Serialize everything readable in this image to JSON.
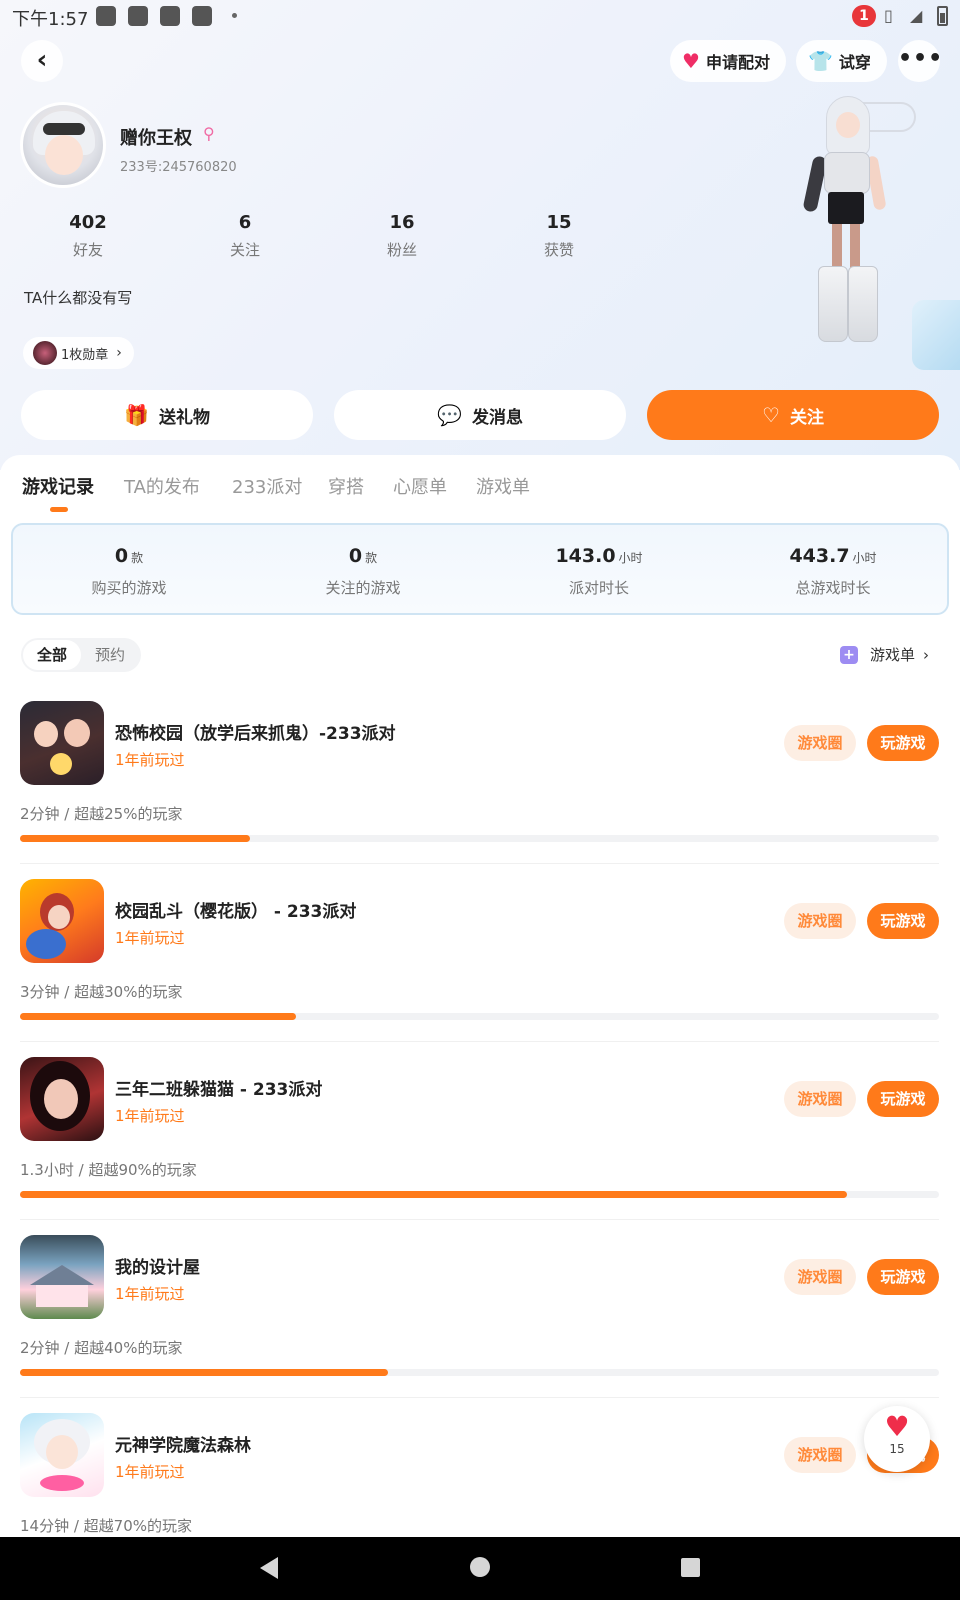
{
  "status_bar": {
    "time": "下午1:57",
    "notification_count": "1"
  },
  "header": {
    "back_icon": "chevron-left-icon",
    "pair_label": "申请配对",
    "tryon_label": "试穿",
    "more_icon": "more-dots-icon"
  },
  "profile": {
    "name": "赠你王权",
    "id_text": "233号:245760820",
    "bio": "TA什么都没有写",
    "medal_label": "1枚勋章",
    "stats": [
      {
        "num": "402",
        "label": "好友"
      },
      {
        "num": "6",
        "label": "关注"
      },
      {
        "num": "16",
        "label": "粉丝"
      },
      {
        "num": "15",
        "label": "获赞"
      }
    ]
  },
  "actions": {
    "gift": "送礼物",
    "message": "发消息",
    "follow": "关注"
  },
  "tabs": [
    "游戏记录",
    "TA的发布",
    "233派对",
    "穿搭",
    "心愿单",
    "游戏单"
  ],
  "summary": [
    {
      "value": "0",
      "unit": "款",
      "label": "购买的游戏"
    },
    {
      "value": "0",
      "unit": "款",
      "label": "关注的游戏"
    },
    {
      "value": "143.0",
      "unit": "小时",
      "label": "派对时长"
    },
    {
      "value": "443.7",
      "unit": "小时",
      "label": "总游戏时长"
    }
  ],
  "filters": [
    "全部",
    "预约"
  ],
  "game_list_link": "游戏单",
  "game_buttons": {
    "circle": "游戏圈",
    "play": "玩游戏"
  },
  "games": [
    {
      "title": "恐怖校园（放学后来抓鬼）-233派对",
      "played": "1年前玩过",
      "meta": "2分钟 / 超越25%的玩家",
      "percent": 25
    },
    {
      "title": "校园乱斗（樱花版） - 233派对",
      "played": "1年前玩过",
      "meta": "3分钟 / 超越30%的玩家",
      "percent": 30
    },
    {
      "title": "三年二班躲猫猫 - 233派对",
      "played": "1年前玩过",
      "meta": "1.3小时 / 超越90%的玩家",
      "percent": 90
    },
    {
      "title": "我的设计屋",
      "played": "1年前玩过",
      "meta": "2分钟 / 超越40%的玩家",
      "percent": 40
    },
    {
      "title": "元神学院魔法森林",
      "played": "1年前玩过",
      "meta": "14分钟 / 超越70%的玩家",
      "percent": 70
    }
  ],
  "favorite_count": "15",
  "colors": {
    "accent": "#ff7a1a",
    "accent_soft": "#fdeee3",
    "heart": "#ef2d4a"
  }
}
